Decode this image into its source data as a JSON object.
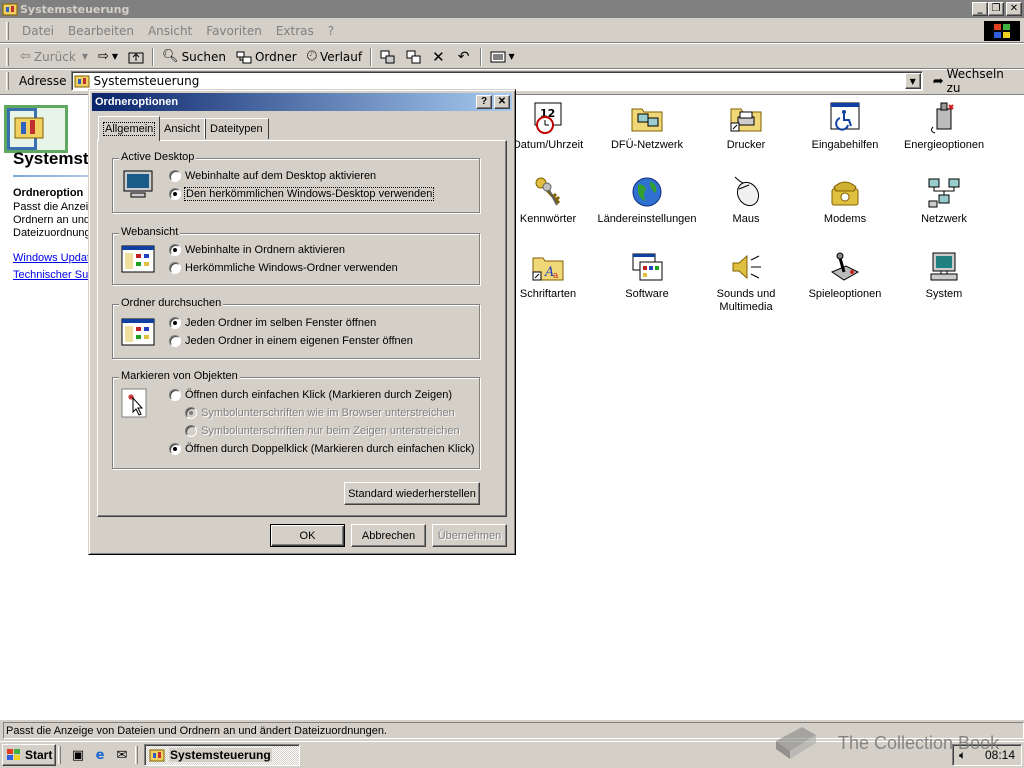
{
  "window": {
    "title": "Systemsteuerung",
    "controls": {
      "minimize": "_",
      "maximize": "❐",
      "close": "✕"
    }
  },
  "menu": [
    {
      "label": "Datei"
    },
    {
      "label": "Bearbeiten"
    },
    {
      "label": "Ansicht"
    },
    {
      "label": "Favoriten"
    },
    {
      "label": "Extras"
    },
    {
      "label": "?"
    }
  ],
  "toolbar": {
    "back": "Zurück",
    "forward_icon": "forward-arrow",
    "search": "Suchen",
    "folders": "Ordner",
    "history": "Verlauf"
  },
  "address": {
    "label": "Adresse",
    "value": "Systemsteuerung",
    "go": "Wechseln zu"
  },
  "left_pane": {
    "title": "Systemst",
    "selected_title": "Ordneroption",
    "description_lines": [
      "Passt die Anzeig",
      "Ordnern an und",
      "Dateizuordnung"
    ],
    "links": [
      "Windows Updat",
      "Technischer Sup"
    ]
  },
  "items": [
    {
      "label": "Datum/Uhrzeit",
      "icon": "clock-calendar-icon"
    },
    {
      "label": "DFÜ-Netzwerk",
      "icon": "dialup-folder-icon"
    },
    {
      "label": "Drucker",
      "icon": "printer-folder-icon"
    },
    {
      "label": "Eingabehilfen",
      "icon": "accessibility-icon"
    },
    {
      "label": "Energieoptionen",
      "icon": "power-options-icon"
    },
    {
      "label": "Kennwörter",
      "icon": "keys-icon"
    },
    {
      "label": "Ländereinstellungen",
      "icon": "globe-icon"
    },
    {
      "label": "Maus",
      "icon": "mouse-icon"
    },
    {
      "label": "Modems",
      "icon": "modem-phone-icon"
    },
    {
      "label": "Netzwerk",
      "icon": "network-icon"
    },
    {
      "label": "Schriftarten",
      "icon": "fonts-folder-icon"
    },
    {
      "label": "Software",
      "icon": "software-icon"
    },
    {
      "label": "Sounds und",
      "label2": "Multimedia",
      "icon": "speaker-icon"
    },
    {
      "label": "Spieleoptionen",
      "icon": "joystick-icon"
    },
    {
      "label": "System",
      "icon": "computer-icon"
    }
  ],
  "status": "Passt die Anzeige von Dateien und Ordnern an und ändert Dateizuordnungen.",
  "taskbar": {
    "start": "Start",
    "task": "Systemsteuerung",
    "clock": "08:14"
  },
  "watermark": "The Collection Book",
  "dialog": {
    "title": "Ordneroptionen",
    "help": "?",
    "close": "✕",
    "tabs": [
      "Allgemein",
      "Ansicht",
      "Dateitypen"
    ],
    "groups": {
      "active_desktop": {
        "legend": "Active Desktop",
        "options": [
          "Webinhalte auf dem Desktop aktivieren",
          "Den herkömmlichen Windows-Desktop verwenden"
        ],
        "selected": 1
      },
      "webview": {
        "legend": "Webansicht",
        "options": [
          "Webinhalte in Ordnern aktivieren",
          "Herkömmliche Windows-Ordner verwenden"
        ],
        "selected": 0
      },
      "browse": {
        "legend": "Ordner durchsuchen",
        "options": [
          "Jeden Ordner im selben Fenster öffnen",
          "Jeden Ordner in einem eigenen Fenster öffnen"
        ],
        "selected": 0
      },
      "click": {
        "legend": "Markieren von Objekten",
        "single": "Öffnen durch einfachen Klick (Markieren durch Zeigen)",
        "sub1": "Symbolunterschriften wie im Browser unterstreichen",
        "sub2": "Symbolunterschriften nur beim Zeigen unterstreichen",
        "double": "Öffnen durch Doppelklick (Markieren durch einfachen Klick)",
        "selected": "double"
      }
    },
    "restore": "Standard wiederherstellen",
    "ok": "OK",
    "cancel": "Abbrechen",
    "apply": "Übernehmen"
  },
  "colors": {
    "dialog_title_start": "#0a246a",
    "dialog_title_end": "#a6caf0",
    "inactive_title": "#808080",
    "face": "#d4d0c8",
    "link": "#0000ee"
  }
}
